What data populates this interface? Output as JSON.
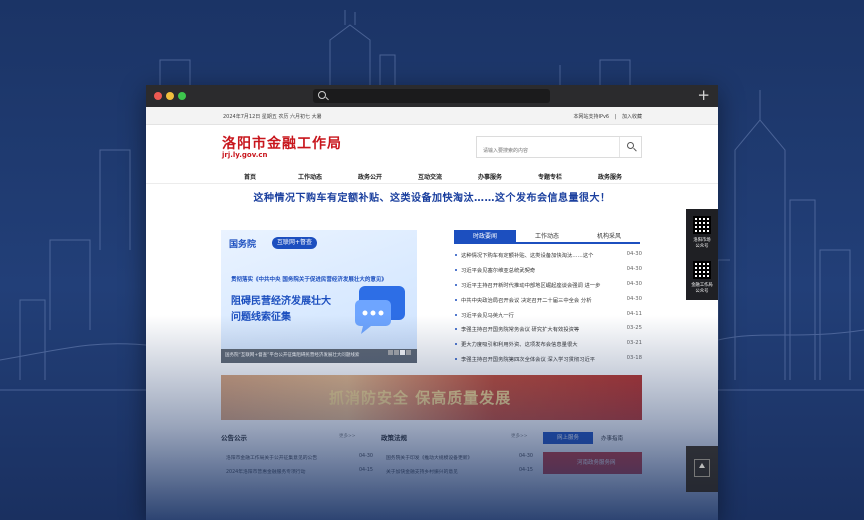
{
  "topbar": {
    "date_text": "2024年7月12日 星期五 农历 六月初七 大暑",
    "ipv6": "本网站支持IPv6",
    "separator": "|",
    "favorite": "加入收藏"
  },
  "header": {
    "title": "洛阳市金融工作局",
    "domain": "jrj.ly.gov.cn"
  },
  "search": {
    "placeholder": "请输入要搜索的内容"
  },
  "nav": [
    "首页",
    "工作动态",
    "政务公开",
    "互动交流",
    "办事服务",
    "专题专栏",
    "政务服务"
  ],
  "headline": "这种情况下购车有定额补贴、这类设备加快淘汰……这个发布会信息量很大！",
  "banner": {
    "brand": "国务院",
    "pill": "互联网+督查",
    "sub": "贯彻落实《中共中央 国务院关于促进民营经济发展壮大的意见》",
    "big1": "阻碍民营经济发展壮大",
    "big2": "问题线索征集",
    "caption": "国务院“互联网+督查”平台公开征集阻碍民营经济发展壮大问题线索"
  },
  "tabs": [
    "时政要闻",
    "工作动态",
    "机构采风"
  ],
  "news": [
    {
      "title": "这种情况下购车有定额补贴、这类设备加快淘汰……这个",
      "date": "04-30"
    },
    {
      "title": "习近平会见塞尔维亚总统武契奇",
      "date": "04-30"
    },
    {
      "title": "习近平主持召开新时代推动中部地区崛起座谈会强调 进一步",
      "date": "04-30"
    },
    {
      "title": "中共中央政治局召开会议 决定召开二十届三中全会 分析",
      "date": "04-30"
    },
    {
      "title": "习近平会见马英九一行",
      "date": "04-11"
    },
    {
      "title": "李强主持召开国务院常务会议 研究扩大有效投资等",
      "date": "03-25"
    },
    {
      "title": "更大力度吸引和利用外资、这项发布会信息量很大",
      "date": "03-21"
    },
    {
      "title": "李强主持召开国务院第四次全体会议 深入学习贯彻习近平",
      "date": "03-18"
    }
  ],
  "ad_text": "抓消防安全  保高质量发展",
  "lower": {
    "notice_title": "公告公示",
    "notice_more": "更多>>",
    "policy_title": "政策法规",
    "policy_more": "更多>>",
    "online_tab": "网上服务",
    "affairs_tab": "办事指南",
    "service_text": "河南政务服务网",
    "notice_items": [
      "洛阳市金融工作局关于公开征集意见的公告",
      "2024年洛阳市普惠金融服务专项行动"
    ],
    "notice_dates": [
      "04-30",
      "04-15"
    ],
    "policy_items": [
      "国务院关于印发《推动大规模设备更新》",
      "关于加快金融支持乡村振兴的意见"
    ],
    "policy_dates": [
      "04-30",
      "04-15"
    ]
  },
  "qr_panel": {
    "label1_line1": "洛阳市场",
    "label1_line2": "公众号",
    "label2_line1": "金融工作局",
    "label2_line2": "公众号"
  },
  "colors": {
    "brand_red": "#c8161d",
    "accent_blue": "#1c4fbf",
    "background_navy": "#1b3466"
  }
}
